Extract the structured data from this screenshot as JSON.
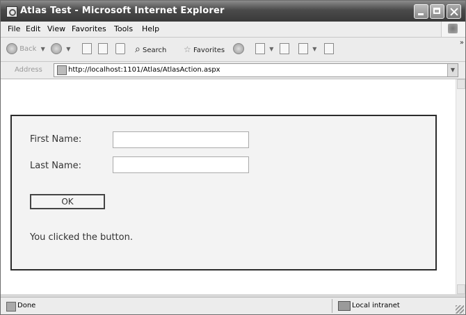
{
  "window": {
    "title": "Atlas Test - Microsoft Internet Explorer"
  },
  "menu": {
    "items": [
      "File",
      "Edit",
      "View",
      "Favorites",
      "Tools",
      "Help"
    ]
  },
  "toolbar": {
    "back_label": "Back",
    "search_label": "Search",
    "favorites_label": "Favorites"
  },
  "address": {
    "label": "Address",
    "url": "http://localhost:1101/Atlas/AtlasAction.aspx"
  },
  "form": {
    "first_name_label": "First Name:",
    "first_name_value": "",
    "last_name_label": "Last Name:",
    "last_name_value": "",
    "ok_label": "OK",
    "result_text": "You clicked the button."
  },
  "status": {
    "text": "Done",
    "zone": "Local intranet"
  }
}
